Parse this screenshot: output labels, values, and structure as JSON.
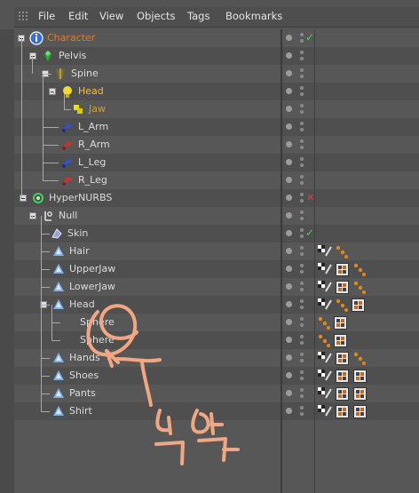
{
  "menu": [
    "File",
    "Edit",
    "View",
    "Objects",
    "Tags",
    "Bookmarks"
  ],
  "objects": [
    {
      "name": "Character",
      "color": "#e07a3a",
      "check": "green"
    },
    {
      "name": "Pelvis"
    },
    {
      "name": "Spine"
    },
    {
      "name": "Head",
      "color": "#f0c040"
    },
    {
      "name": "Jaw",
      "color": "#d8a030"
    },
    {
      "name": "L_Arm"
    },
    {
      "name": "R_Arm"
    },
    {
      "name": "L_Leg"
    },
    {
      "name": "R_Leg"
    },
    {
      "name": "HyperNURBS",
      "check": "red"
    },
    {
      "name": "Null"
    },
    {
      "name": "Skin",
      "check": "green"
    },
    {
      "name": "Hair"
    },
    {
      "name": "UpperJaw"
    },
    {
      "name": "LowerJaw"
    },
    {
      "name": "Head"
    },
    {
      "name": "Sphere"
    },
    {
      "name": "Sphere"
    },
    {
      "name": "Hands"
    },
    {
      "name": "Shoes"
    },
    {
      "name": "Pants"
    },
    {
      "name": "Shirt"
    }
  ],
  "annotation": "눈악",
  "colors": {
    "panel": "#575757",
    "alt_row": "#4f4f4f",
    "annotation": "#f2a784",
    "selected": "#f0c040"
  }
}
